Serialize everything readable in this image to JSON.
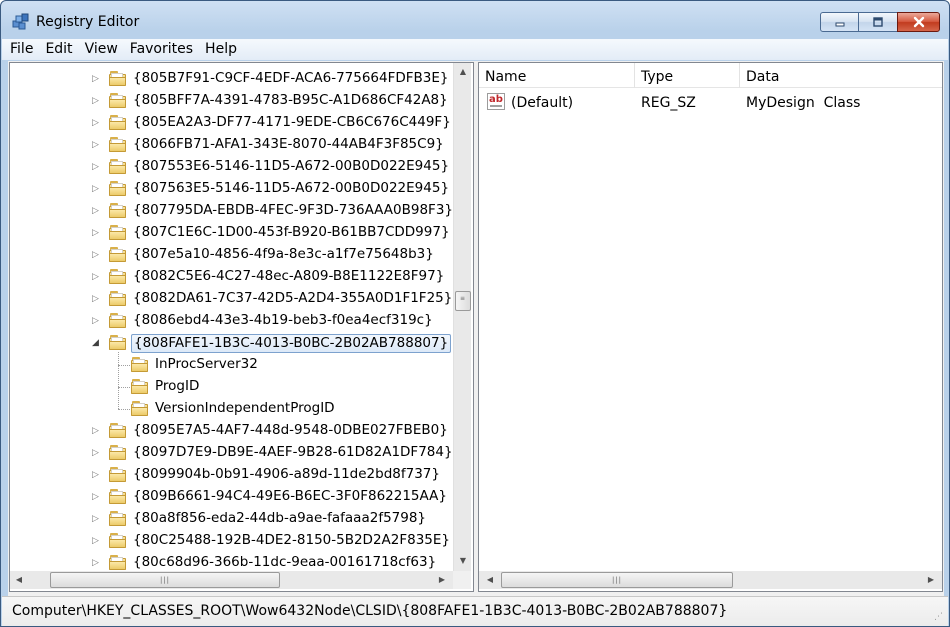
{
  "window": {
    "title": "Registry Editor"
  },
  "menu": [
    "File",
    "Edit",
    "View",
    "Favorites",
    "Help"
  ],
  "tree": {
    "nodes": [
      {
        "label": "{805B7F91-C9CF-4EDF-ACA6-775664FDFB3E}",
        "level": 0,
        "expander": "collapsed"
      },
      {
        "label": "{805BFF7A-4391-4783-B95C-A1D686CF42A8}",
        "level": 0,
        "expander": "collapsed"
      },
      {
        "label": "{805EA2A3-DF77-4171-9EDE-CB6C676C449F}",
        "level": 0,
        "expander": "collapsed"
      },
      {
        "label": "{8066FB71-AFA1-343E-8070-44AB4F3F85C9}",
        "level": 0,
        "expander": "collapsed"
      },
      {
        "label": "{807553E6-5146-11D5-A672-00B0D022E945}",
        "level": 0,
        "expander": "collapsed"
      },
      {
        "label": "{807563E5-5146-11D5-A672-00B0D022E945}",
        "level": 0,
        "expander": "collapsed"
      },
      {
        "label": "{807795DA-EBDB-4FEC-9F3D-736AAA0B98F3}",
        "level": 0,
        "expander": "collapsed"
      },
      {
        "label": "{807C1E6C-1D00-453f-B920-B61BB7CDD997}",
        "level": 0,
        "expander": "collapsed"
      },
      {
        "label": "{807e5a10-4856-4f9a-8e3c-a1f7e75648b3}",
        "level": 0,
        "expander": "collapsed"
      },
      {
        "label": "{8082C5E6-4C27-48ec-A809-B8E1122E8F97}",
        "level": 0,
        "expander": "collapsed"
      },
      {
        "label": "{8082DA61-7C37-42D5-A2D4-355A0D1F1F25}",
        "level": 0,
        "expander": "collapsed"
      },
      {
        "label": "{8086ebd4-43e3-4b19-beb3-f0ea4ecf319c}",
        "level": 0,
        "expander": "collapsed"
      },
      {
        "label": "{808FAFE1-1B3C-4013-B0BC-2B02AB788807}",
        "level": 0,
        "expander": "expanded",
        "selected": true
      },
      {
        "label": "InProcServer32",
        "level": 1,
        "expander": "none"
      },
      {
        "label": "ProgID",
        "level": 1,
        "expander": "none"
      },
      {
        "label": "VersionIndependentProgID",
        "level": 1,
        "expander": "none"
      },
      {
        "label": "{8095E7A5-4AF7-448d-9548-0DBE027FBEB0}",
        "level": 0,
        "expander": "collapsed"
      },
      {
        "label": "{8097D7E9-DB9E-4AEF-9B28-61D82A1DF784}",
        "level": 0,
        "expander": "collapsed"
      },
      {
        "label": "{8099904b-0b91-4906-a89d-11de2bd8f737}",
        "level": 0,
        "expander": "collapsed"
      },
      {
        "label": "{809B6661-94C4-49E6-B6EC-3F0F862215AA}",
        "level": 0,
        "expander": "collapsed"
      },
      {
        "label": "{80a8f856-eda2-44db-a9ae-fafaaa2f5798}",
        "level": 0,
        "expander": "collapsed"
      },
      {
        "label": "{80C25488-192B-4DE2-8150-5B2D2A2F835E}",
        "level": 0,
        "expander": "collapsed"
      },
      {
        "label": "{80c68d96-366b-11dc-9eaa-00161718cf63}",
        "level": 0,
        "expander": "collapsed"
      }
    ]
  },
  "values": {
    "columns": [
      "Name",
      "Type",
      "Data"
    ],
    "rows": [
      {
        "name": "(Default)",
        "type": "REG_SZ",
        "data": "MyDesign  Class",
        "icon": "string-value-icon",
        "icon_text": "ab"
      }
    ]
  },
  "status": {
    "path": "Computer\\HKEY_CLASSES_ROOT\\Wow6432Node\\CLSID\\{808FAFE1-1B3C-4013-B0BC-2B02AB788807}"
  },
  "icons": {
    "expander_collapsed": "▷",
    "expander_expanded": "◢",
    "scroll_up": "▲",
    "scroll_down": "▼",
    "scroll_left": "◀",
    "scroll_right": "▶"
  },
  "colors": {
    "selection_border": "#7da2ce",
    "title_gradient": "#b9d1ea",
    "close_button": "#c13b1e"
  }
}
